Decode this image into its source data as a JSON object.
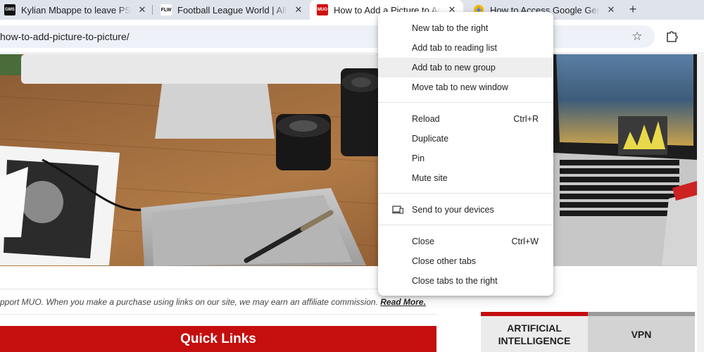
{
  "tabs": [
    {
      "favicon": "GMS",
      "title": "Kylian Mbappe to leave PSG",
      "close": "✕"
    },
    {
      "favicon": "FLW",
      "title": "Football League World | All a",
      "close": "✕"
    },
    {
      "favicon": "MUO",
      "title": "How to Add a Picture to Andr",
      "close": "✕"
    },
    {
      "favicon": "gemini-icon",
      "title": "How to Access Google Gem",
      "close": "✕"
    }
  ],
  "new_tab_label": "+",
  "omnibox": {
    "url": "how-to-add-picture-to-picture/"
  },
  "toolbar": {
    "star": "☆"
  },
  "page": {
    "disclaimer_text": "pport MUO. When you make a purchase using links on our site, we may earn an affiliate commission.",
    "read_more": "Read More.",
    "quick_links": "Quick Links",
    "categories": [
      "ARTIFICIAL INTELLIGENCE",
      "VPN"
    ]
  },
  "context_menu": {
    "groups": [
      [
        {
          "label": "New tab to the right"
        },
        {
          "label": "Add tab to reading list"
        },
        {
          "label": "Add tab to new group",
          "hovered": true
        },
        {
          "label": "Move tab to new window"
        }
      ],
      [
        {
          "label": "Reload",
          "shortcut": "Ctrl+R"
        },
        {
          "label": "Duplicate"
        },
        {
          "label": "Pin"
        },
        {
          "label": "Mute site"
        }
      ],
      [
        {
          "label": "Send to your devices",
          "icon": "devices-icon"
        }
      ],
      [
        {
          "label": "Close",
          "shortcut": "Ctrl+W"
        },
        {
          "label": "Close other tabs"
        },
        {
          "label": "Close tabs to the right"
        }
      ]
    ]
  },
  "colors": {
    "tabstrip": "#dfe3eb",
    "omnibox": "#eef1f8",
    "muo_red": "#c50e0e"
  }
}
